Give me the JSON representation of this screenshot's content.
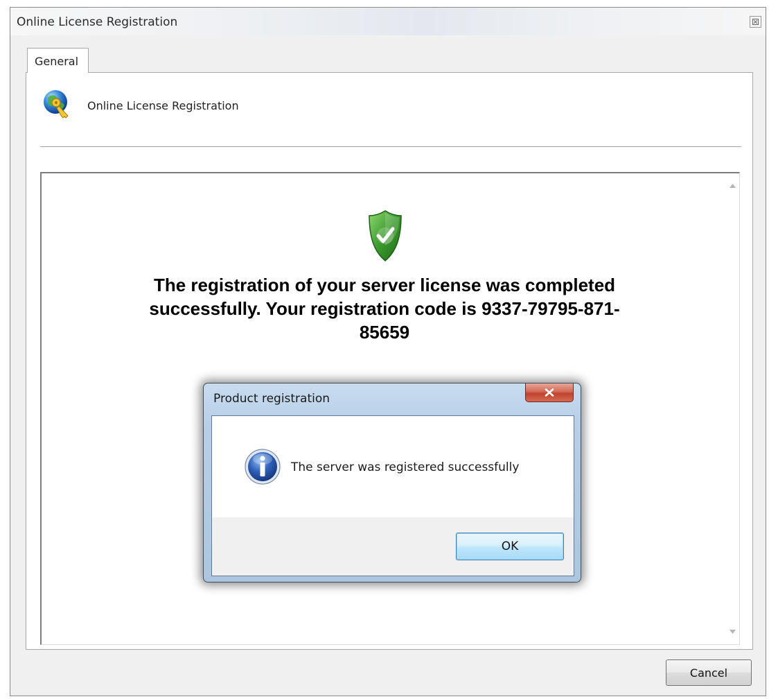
{
  "window": {
    "title": "Online License Registration"
  },
  "tabs": [
    {
      "label": "General",
      "active": true
    }
  ],
  "header": {
    "label": "Online License Registration",
    "icon": "globe-key-icon"
  },
  "content": {
    "status_icon": "shield-check-icon",
    "message": "The registration of your server license was completed successfully. Your registration code is 9337-79795-871-85659"
  },
  "footer": {
    "cancel_label": "Cancel"
  },
  "dialog": {
    "title": "Product registration",
    "close_glyph": "X",
    "icon": "info-icon",
    "message": "The server was registered successfully",
    "ok_label": "OK"
  },
  "colors": {
    "shield_green": "#3c9a2e",
    "info_blue": "#2e5fb8",
    "close_red": "#c0432f"
  }
}
